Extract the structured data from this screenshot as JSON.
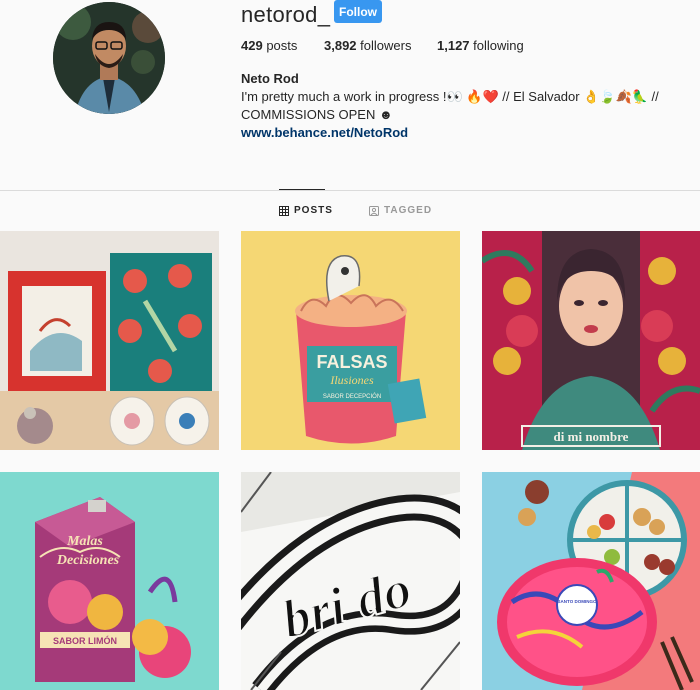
{
  "profile": {
    "username": "netorod_",
    "follow_label": "Follow",
    "stats": {
      "posts_count": "429",
      "posts_label": "posts",
      "followers_count": "3,892",
      "followers_label": "followers",
      "following_count": "1,127",
      "following_label": "following"
    },
    "full_name": "Neto Rod",
    "bio_line1": "I'm pretty much a work in progress !👀 🔥❤️ // El Salvador 👌🍃🍂🦜 //",
    "bio_line2": "COMMISSIONS OPEN ☻",
    "website": "www.behance.net/NetoRod"
  },
  "tabs": [
    {
      "label": "POSTS",
      "icon": "grid-icon",
      "active": true
    },
    {
      "label": "TAGGED",
      "icon": "tag-icon",
      "active": false
    }
  ],
  "posts": {
    "post2_text1": "FALSAS",
    "post2_text2": "Ilusiones",
    "post2_text3": "SABOR DECEPCIÓN",
    "post3_text": "di mi nombre",
    "post4_text1": "Malas",
    "post4_text2": "Decisiones",
    "post4_text3": "SABOR LIMÓN",
    "post5_text": "bri do",
    "post6_text": "SANTO DOMINGO"
  },
  "colors": {
    "follow_button": "#3897f0",
    "link": "#003569",
    "background": "#fafafa"
  }
}
